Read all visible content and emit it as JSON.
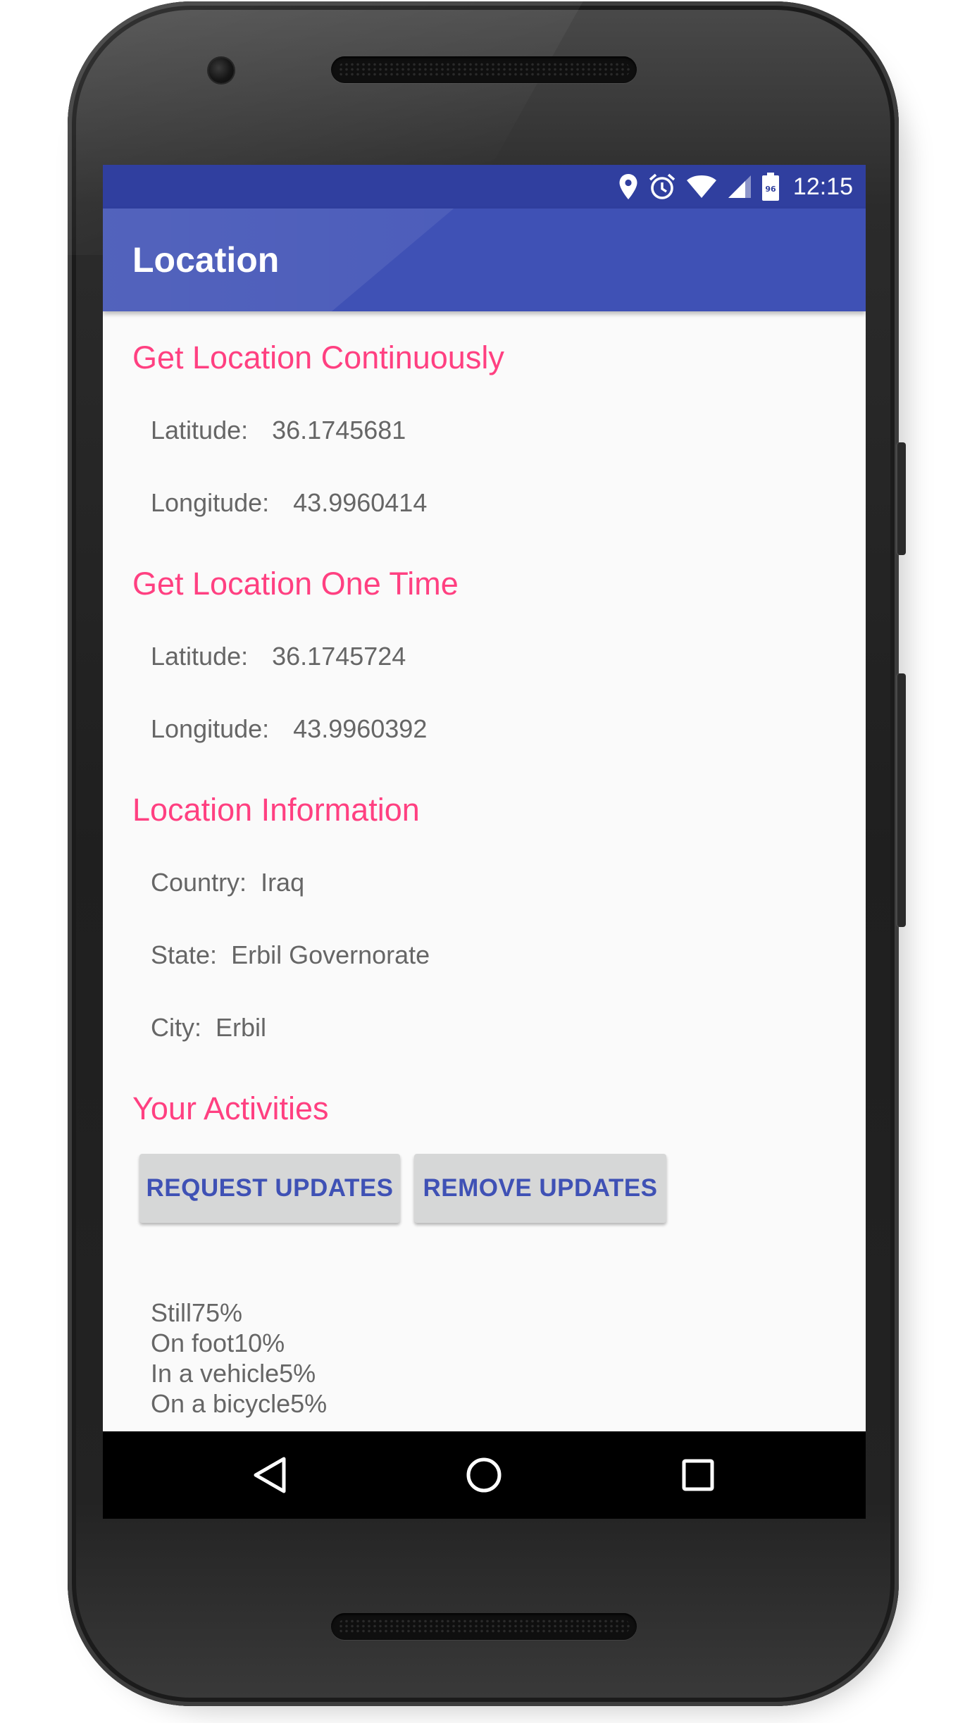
{
  "status_bar": {
    "time": "12:15",
    "battery_level": "96",
    "icons": [
      "location-icon",
      "alarm-icon",
      "wifi-icon",
      "cell-signal-icon",
      "battery-icon"
    ]
  },
  "app_bar": {
    "title": "Location"
  },
  "sections": {
    "continuous": {
      "title": "Get Location Continuously",
      "latitude_label": "Latitude:",
      "latitude_value": "36.1745681",
      "longitude_label": "Longitude:",
      "longitude_value": "43.9960414"
    },
    "one_time": {
      "title": "Get Location One Time",
      "latitude_label": "Latitude:",
      "latitude_value": "36.1745724",
      "longitude_label": "Longitude:",
      "longitude_value": "43.9960392"
    },
    "info": {
      "title": "Location Information",
      "country_label": "Country:",
      "country_value": "Iraq",
      "state_label": "State:",
      "state_value": "Erbil Governorate",
      "city_label": "City:",
      "city_value": "Erbil"
    },
    "activities": {
      "title": "Your Activities",
      "request_button": "REQUEST UPDATES",
      "remove_button": "REMOVE UPDATES",
      "items": [
        "Still75%",
        "On foot10%",
        "In a vehicle5%",
        "On a bicycle5%"
      ]
    }
  },
  "nav_bar": {
    "icons": [
      "back-icon",
      "home-icon",
      "recents-icon"
    ]
  },
  "colors": {
    "status_bar": "#303f9f",
    "app_bar": "#3f51b5",
    "section_title": "#ff4081",
    "body_text": "#666666",
    "button_bg": "#d6d7d7",
    "button_text": "#3f51b5"
  }
}
